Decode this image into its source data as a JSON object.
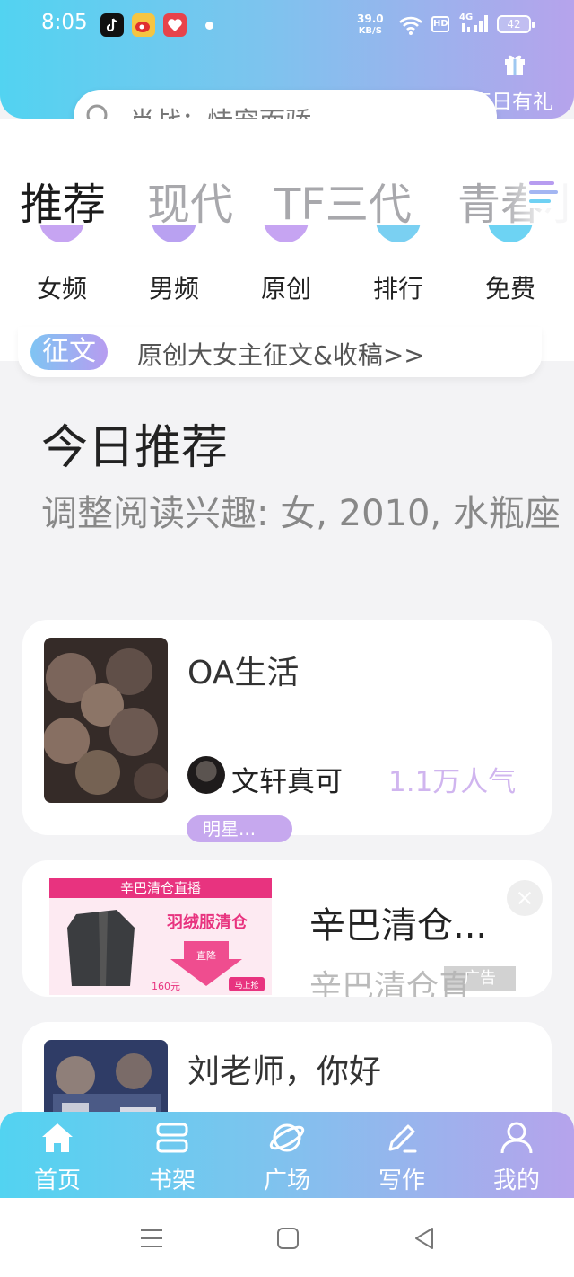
{
  "status_bar": {
    "time": "8:05",
    "network_speed": "39.0",
    "network_unit": "KB/S",
    "hd": "HD",
    "signal": "4G",
    "battery": "42"
  },
  "header": {
    "search_placeholder": "肖战：恃宠而骄",
    "gift_label": "每日有礼"
  },
  "tabs": [
    "推荐",
    "现代",
    "TF三代",
    "青春小"
  ],
  "categories": [
    {
      "label": "女频",
      "color": "#c6a4f2"
    },
    {
      "label": "男频",
      "color": "#b9a1f1"
    },
    {
      "label": "原创",
      "color": "#c6a4f2"
    },
    {
      "label": "排行",
      "color": "#7ad0f2"
    },
    {
      "label": "免费",
      "color": "#6dd3f3"
    }
  ],
  "banner": {
    "tag": "征文",
    "text": "原创大女主征文&收稿>>"
  },
  "section": {
    "title": "今日推荐",
    "subtitle": "调整阅读兴趣: 女, 2010, 水瓶座"
  },
  "books": [
    {
      "title": "OA生活",
      "author": "文轩真可",
      "popularity": "1.1万人气",
      "tag": "明星..."
    },
    {
      "title": "刘老师，你好",
      "author": "",
      "popularity": "",
      "tag": ""
    }
  ],
  "ad": {
    "title": "辛巴清仓...",
    "subtitle": "辛巴清仓直",
    "label": "广告",
    "image_header": "辛巴清仓直播",
    "image_text": "羽绒服清仓",
    "image_price": "160元",
    "image_button": "马上抢",
    "image_arrow": "直降"
  },
  "bottom_nav": [
    {
      "label": "首页",
      "icon": "home-icon"
    },
    {
      "label": "书架",
      "icon": "bookshelf-icon"
    },
    {
      "label": "广场",
      "icon": "planet-icon"
    },
    {
      "label": "写作",
      "icon": "pen-icon"
    },
    {
      "label": "我的",
      "icon": "user-icon"
    }
  ],
  "colors": {
    "gradient_start": "#52d3f1",
    "gradient_end": "#b6a3ec",
    "popularity": "#d0b5ef"
  }
}
